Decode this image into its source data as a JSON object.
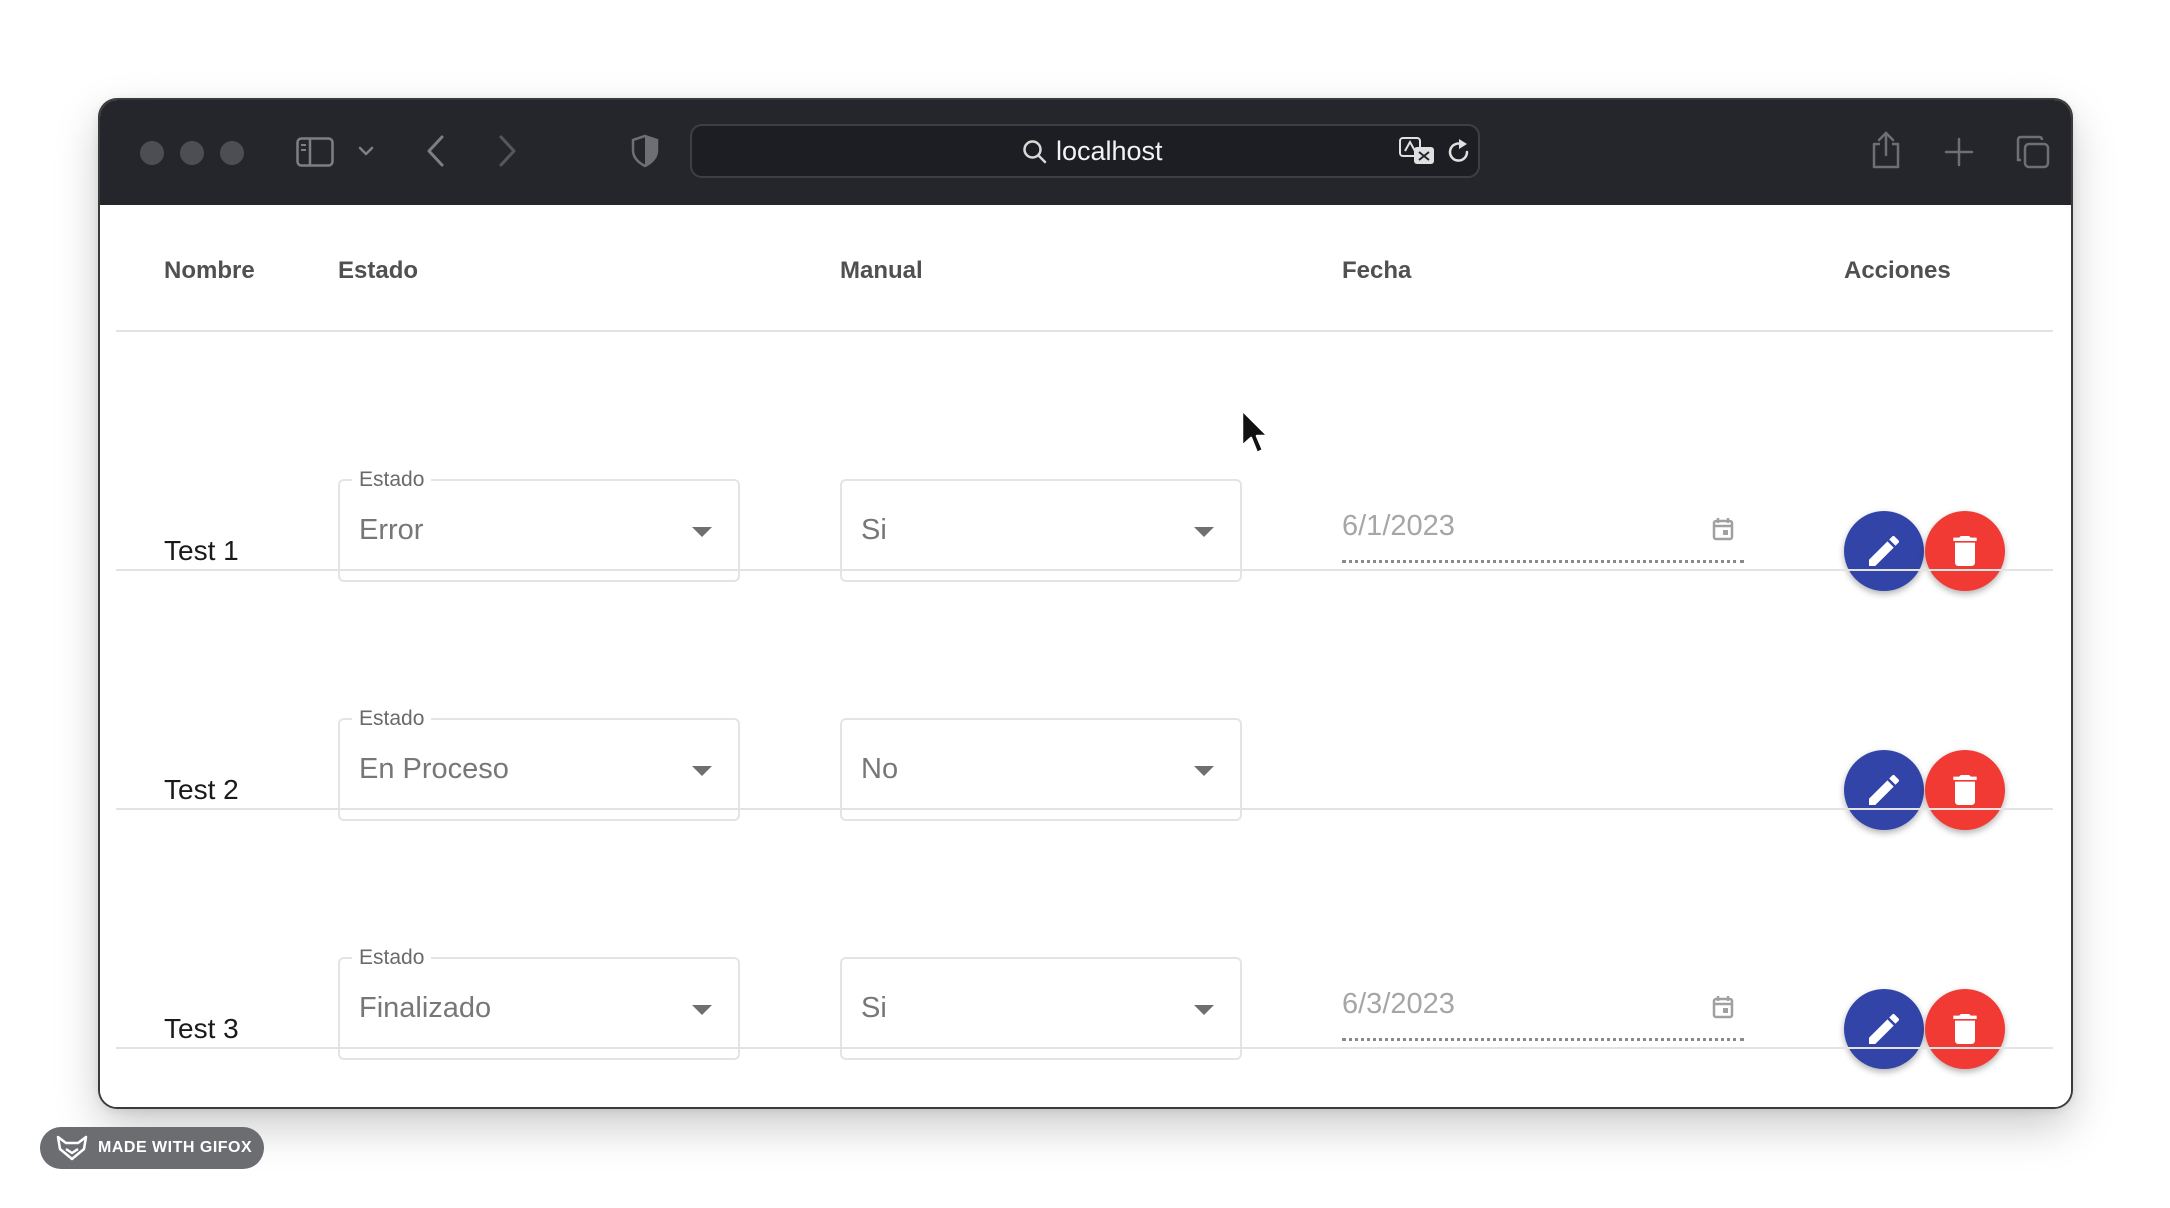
{
  "browser": {
    "url": "localhost",
    "colors": {
      "toolbar": "#25262c",
      "address_bar": "#1d1e23"
    },
    "icons": [
      "sidebar-icon",
      "chevron-down-icon",
      "back-icon",
      "forward-icon",
      "shield-icon",
      "search-icon",
      "translate-icon",
      "reload-icon",
      "share-icon",
      "plus-icon",
      "tabs-icon"
    ]
  },
  "table": {
    "headers": {
      "name": "Nombre",
      "status": "Estado",
      "manual": "Manual",
      "date": "Fecha",
      "actions": "Acciones"
    },
    "status_field_label": "Estado",
    "rows": [
      {
        "name": "Test 1",
        "status": "Error",
        "manual": "Si",
        "date": "6/1/2023"
      },
      {
        "name": "Test 2",
        "status": "En Proceso",
        "manual": "No",
        "date": ""
      },
      {
        "name": "Test 3",
        "status": "Finalizado",
        "manual": "Si",
        "date": "6/3/2023"
      }
    ],
    "colors": {
      "edit": "#3344a8",
      "delete": "#f03a33"
    }
  },
  "watermark": {
    "label": "MADE WITH GIFOX"
  }
}
